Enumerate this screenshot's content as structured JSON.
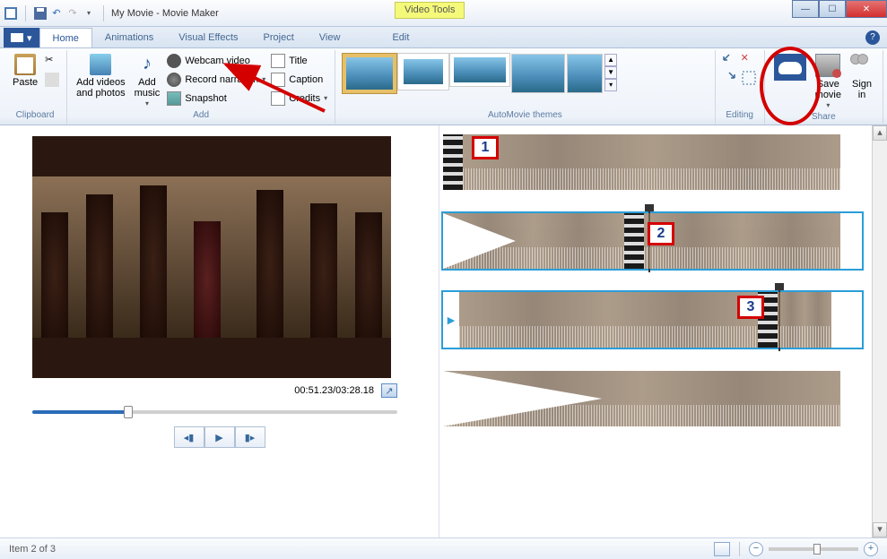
{
  "window": {
    "title": "My Movie - Movie Maker",
    "contextual_tab": "Video Tools"
  },
  "tabs": {
    "home": "Home",
    "animations": "Animations",
    "visual_effects": "Visual Effects",
    "project": "Project",
    "view": "View",
    "edit": "Edit"
  },
  "ribbon": {
    "clipboard": {
      "label": "Clipboard",
      "paste": "Paste"
    },
    "add": {
      "label": "Add",
      "add_videos": "Add videos\nand photos",
      "add_music": "Add\nmusic",
      "webcam": "Webcam video",
      "record": "Record narration",
      "snapshot": "Snapshot",
      "title": "Title",
      "caption": "Caption",
      "credits": "Credits"
    },
    "automovie": {
      "label": "AutoMovie themes"
    },
    "editing": {
      "label": "Editing"
    },
    "share": {
      "label": "Share",
      "save_movie": "Save\nmovie",
      "sign_in": "Sign\nin"
    }
  },
  "preview": {
    "time": "00:51.23/03:28.18"
  },
  "timeline": {
    "markers": [
      "1",
      "2",
      "3"
    ]
  },
  "status": {
    "text": "Item 2 of 3"
  }
}
